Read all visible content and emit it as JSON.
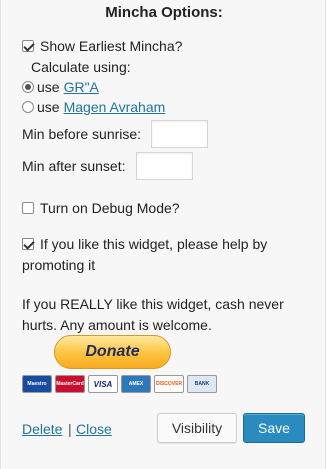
{
  "title": "Mincha Options:",
  "show_earliest": {
    "label": "Show Earliest Mincha?",
    "checked": true
  },
  "calc_label": "Calculate using:",
  "radios": [
    {
      "prefix": "use",
      "link": "GR\"A",
      "checked": true
    },
    {
      "prefix": "use",
      "link": "Magen Avraham",
      "checked": false
    }
  ],
  "fields": {
    "before_sunrise": {
      "label": "Min before sunrise:",
      "value": ""
    },
    "after_sunset": {
      "label": "Min after sunset:",
      "value": ""
    }
  },
  "debug": {
    "label": "Turn on Debug Mode?",
    "checked": false
  },
  "promote": {
    "label": "If you like this widget, please help by promoting it",
    "checked": true
  },
  "cash_note": "If you REALLY like this widget, cash never hurts. Any amount is welcome.",
  "donate_label": "Donate",
  "cards": [
    "Maestro",
    "MasterCard",
    "VISA",
    "AMEX",
    "DISCOVER",
    "BANK"
  ],
  "footer": {
    "delete_label": "Delete",
    "separator": "|",
    "close_label": "Close",
    "visibility_label": "Visibility",
    "save_label": "Save"
  },
  "colors": {
    "link": "#21759b",
    "primary_button": "#2a8bc1",
    "donate": "#fcc43f"
  }
}
